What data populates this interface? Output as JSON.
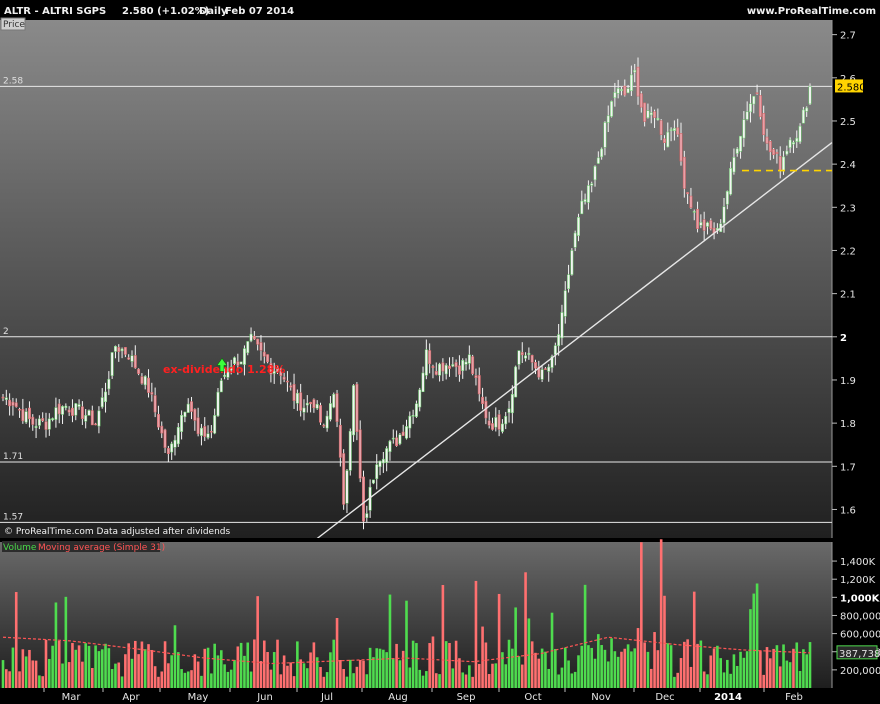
{
  "header": {
    "instrument": "ALTR - ALTRI SGPS",
    "quote": "2.580 (+1.02%)",
    "period": "Daily",
    "date": "Feb 07 2014",
    "site": "www.ProRealTime.com"
  },
  "price_panel": {
    "label": "Price",
    "copyright": "© ProRealTime.com Data adjusted after dividends",
    "annotation": "ex-dividendo 1.28%",
    "last_price_badge": "2.580"
  },
  "volume_panel": {
    "label_volume": "Volume",
    "label_ma": "Moving average (Simple 31)",
    "ma_badge": "387,738"
  },
  "colors": {
    "background_top": "#8a8a8a",
    "background_bottom": "#1a1a1a",
    "up": "#39d439",
    "down": "#ff6a6a",
    "line": "#e8e8e8",
    "badge": "#ffd400"
  },
  "chart_data": [
    {
      "type": "candlestick",
      "title": "ALTR - ALTRI SGPS",
      "ylim": [
        1.52,
        2.72
      ],
      "y_ticks": [
        "1.6",
        "1.7",
        "1.8",
        "1.9",
        "2",
        "2.1",
        "2.2",
        "2.3",
        "2.4",
        "2.5",
        "2.6",
        "2.7"
      ],
      "x_labels": [
        "Mar",
        "Apr",
        "May",
        "Jun",
        "Jul",
        "Aug",
        "Sep",
        "Oct",
        "Nov",
        "Dec",
        "2014",
        "Feb"
      ],
      "horizontal_levels": [
        {
          "label": "2.58",
          "value": 2.58
        },
        {
          "label": "2",
          "value": 2.0
        },
        {
          "label": "1.71",
          "value": 1.71
        },
        {
          "label": "1.57",
          "value": 1.57
        }
      ],
      "dashed_support": 2.385,
      "trendline": [
        {
          "x": "Jul",
          "y": 1.52
        },
        {
          "x": "Feb",
          "y": 2.45
        }
      ],
      "close_path": [
        [
          "Feb",
          1.86
        ],
        [
          "Feb",
          1.85
        ],
        [
          "Feb",
          1.82
        ],
        [
          "Feb",
          1.8
        ],
        [
          "Feb",
          1.8
        ],
        [
          "Feb",
          1.83
        ],
        [
          "Feb",
          1.84
        ],
        [
          "Mar",
          1.83
        ],
        [
          "Mar",
          1.82
        ],
        [
          "Mar",
          1.8
        ],
        [
          "Mar",
          1.88
        ],
        [
          "Mar",
          1.98
        ],
        [
          "Mar",
          1.96
        ],
        [
          "Mar",
          1.92
        ],
        [
          "Mar",
          1.88
        ],
        [
          "Mar",
          1.8
        ],
        [
          "Apr",
          1.72
        ],
        [
          "Apr",
          1.8
        ],
        [
          "Apr",
          1.86
        ],
        [
          "Apr",
          1.77
        ],
        [
          "Apr",
          1.78
        ],
        [
          "Apr",
          1.9
        ],
        [
          "May",
          1.94
        ],
        [
          "May",
          1.95
        ],
        [
          "May",
          1.99
        ],
        [
          "May",
          1.96
        ],
        [
          "May",
          1.93
        ],
        [
          "May",
          1.92
        ],
        [
          "Jun",
          1.86
        ],
        [
          "Jun",
          1.84
        ],
        [
          "Jun",
          1.85
        ],
        [
          "Jun",
          1.78
        ],
        [
          "Jun",
          1.88
        ],
        [
          "Jun",
          1.62
        ],
        [
          "Jul",
          1.88
        ],
        [
          "Jul",
          1.56
        ],
        [
          "Jul",
          1.72
        ],
        [
          "Jul",
          1.74
        ],
        [
          "Jul",
          1.76
        ],
        [
          "Jul",
          1.8
        ],
        [
          "Aug",
          1.85
        ],
        [
          "Aug",
          1.96
        ],
        [
          "Aug",
          1.93
        ],
        [
          "Aug",
          1.94
        ],
        [
          "Aug",
          1.93
        ],
        [
          "Aug",
          1.95
        ],
        [
          "Sep",
          1.86
        ],
        [
          "Sep",
          1.8
        ],
        [
          "Sep",
          1.8
        ],
        [
          "Sep",
          1.84
        ],
        [
          "Sep",
          1.97
        ],
        [
          "Sep",
          1.94
        ],
        [
          "Oct",
          1.91
        ],
        [
          "Oct",
          1.94
        ],
        [
          "Oct",
          2.04
        ],
        [
          "Oct",
          2.2
        ],
        [
          "Oct",
          2.3
        ],
        [
          "Oct",
          2.35
        ],
        [
          "Nov",
          2.45
        ],
        [
          "Nov",
          2.57
        ],
        [
          "Nov",
          2.56
        ],
        [
          "Nov",
          2.61
        ],
        [
          "Nov",
          2.5
        ],
        [
          "Nov",
          2.52
        ],
        [
          "Dec",
          2.46
        ],
        [
          "Dec",
          2.5
        ],
        [
          "Dec",
          2.36
        ],
        [
          "Dec",
          2.26
        ],
        [
          "Dec",
          2.25
        ],
        [
          "Dec",
          2.24
        ],
        [
          "2014",
          2.34
        ],
        [
          "2014",
          2.45
        ],
        [
          "2014",
          2.53
        ],
        [
          "2014",
          2.57
        ],
        [
          "2014",
          2.44
        ],
        [
          "Feb",
          2.4
        ],
        [
          "Feb",
          2.46
        ],
        [
          "Feb",
          2.48
        ],
        [
          "Feb",
          2.58
        ]
      ],
      "last_value": 2.58
    },
    {
      "type": "bar",
      "ylim": [
        0,
        1500000
      ],
      "y_ticks": [
        "200,000",
        "400,000",
        "600,000",
        "800,000",
        "1,000K",
        "1,200K",
        "1,400K"
      ],
      "series": [
        {
          "name": "Volume"
        },
        {
          "name": "Moving average (Simple 31)",
          "last_value": 387738
        }
      ],
      "ma_path": [
        [
          "Feb",
          560000
        ],
        [
          "Mar",
          520000
        ],
        [
          "Apr",
          430000
        ],
        [
          "May",
          330000
        ],
        [
          "Jun",
          270000
        ],
        [
          "Jul",
          300000
        ],
        [
          "Aug",
          330000
        ],
        [
          "Sep",
          290000
        ],
        [
          "Oct",
          380000
        ],
        [
          "Nov",
          560000
        ],
        [
          "Dec",
          480000
        ],
        [
          "2014",
          420000
        ],
        [
          "Feb",
          387738
        ]
      ]
    }
  ]
}
